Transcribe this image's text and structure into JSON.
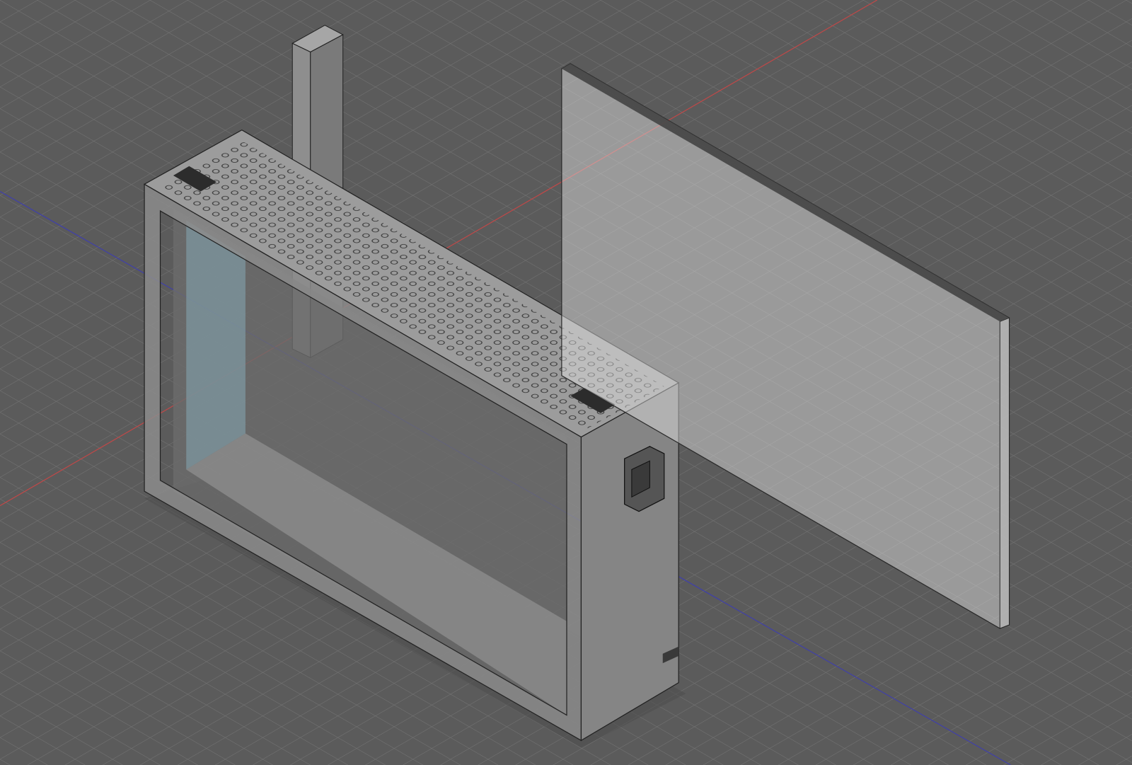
{
  "viewport": {
    "background_color": "#5b5b5b",
    "grid_color": "#777777",
    "x_axis_color": "#c04040",
    "y_axis_color": "#3a3aa0",
    "body_color": "#8a8a8a",
    "glass_color": "#e8e8e8"
  }
}
